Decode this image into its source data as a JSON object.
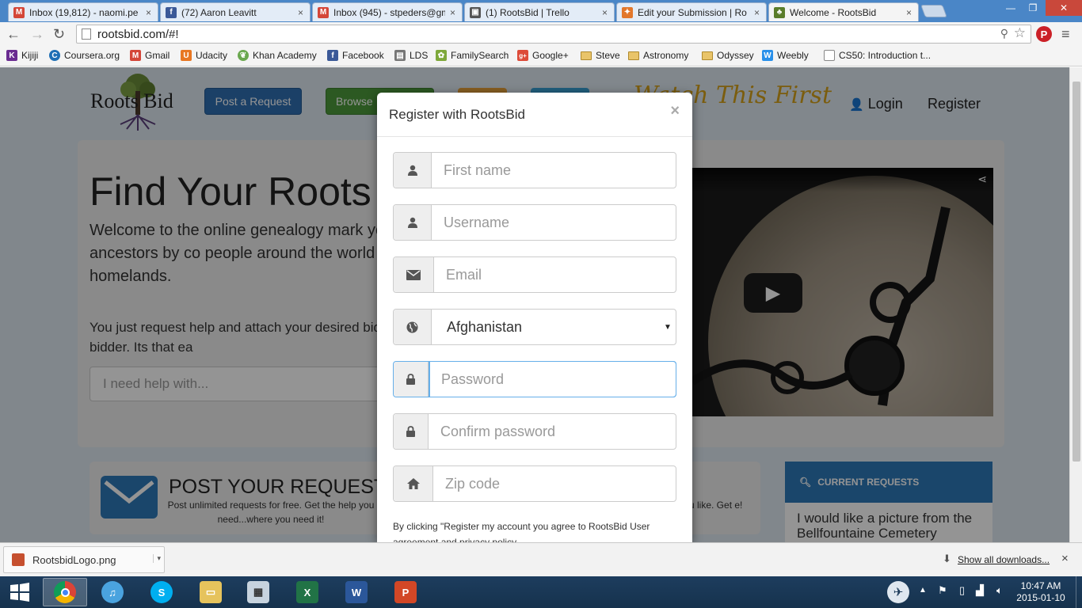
{
  "browser": {
    "tabs": [
      {
        "label": "Inbox (19,812) - naomi.pe",
        "icon": "gmail-icon",
        "color": "#d44638",
        "glyph": "M"
      },
      {
        "label": "(72) Aaron Leavitt",
        "icon": "facebook-icon",
        "color": "#3b5998",
        "glyph": "f"
      },
      {
        "label": "Inbox (945) - stpeders@gm",
        "icon": "gmail-icon",
        "color": "#d44638",
        "glyph": "M"
      },
      {
        "label": "(1) RootsBid | Trello",
        "icon": "trello-icon",
        "color": "#555555",
        "glyph": "▣"
      },
      {
        "label": "Edit your Submission | Ro",
        "icon": "puzzle-icon",
        "color": "#e2772b",
        "glyph": "✦"
      },
      {
        "label": "Welcome - RootsBid",
        "icon": "tree-icon",
        "color": "#5a7d2a",
        "glyph": "♣"
      }
    ],
    "tab_close": "×",
    "url": "rootsbid.com/#!",
    "nav": {
      "back": "←",
      "forward": "→",
      "reload": "↻"
    },
    "bookmarks": [
      {
        "label": "Kijiji",
        "icon": "kijiji-icon",
        "color": "#6a2c91",
        "glyph": "K"
      },
      {
        "label": "Coursera.org",
        "icon": "coursera-icon",
        "color": "#1f6fb5",
        "glyph": "C"
      },
      {
        "label": "Gmail",
        "icon": "gmail-icon",
        "color": "#d44638",
        "glyph": "M"
      },
      {
        "label": "Udacity",
        "icon": "udacity-icon",
        "color": "#e87722",
        "glyph": "U"
      },
      {
        "label": "Khan Academy",
        "icon": "khan-academy-icon",
        "color": "#6aa84f",
        "glyph": "❦"
      },
      {
        "label": "Facebook",
        "icon": "facebook-icon",
        "color": "#3b5998",
        "glyph": "f"
      },
      {
        "label": "LDS",
        "icon": "page-icon",
        "color": "#777777",
        "glyph": "▤"
      },
      {
        "label": "FamilySearch",
        "icon": "familysearch-icon",
        "color": "#7ea83a",
        "glyph": "✿"
      },
      {
        "label": "Google+",
        "icon": "google-plus-icon",
        "color": "#dd4b39",
        "glyph": "g+"
      },
      {
        "label": "Steve",
        "icon": "folder-icon",
        "color": "#e9c46a",
        "glyph": ""
      },
      {
        "label": "Astronomy",
        "icon": "folder-icon",
        "color": "#e9c46a",
        "glyph": ""
      },
      {
        "label": "Odyssey",
        "icon": "folder-icon",
        "color": "#e9c46a",
        "glyph": ""
      },
      {
        "label": "Weebly",
        "icon": "weebly-icon",
        "color": "#2990ea",
        "glyph": "W"
      },
      {
        "label": "CS50: Introduction t...",
        "icon": "page-icon",
        "color": "#888888",
        "glyph": "▢"
      }
    ]
  },
  "site": {
    "logo_text": "Roots Bid",
    "nav": {
      "post": "Post a Request",
      "browse": "Browse",
      "watch": "Watch This First",
      "login": "Login",
      "register": "Register"
    },
    "hero": {
      "title": "Find Your Roots",
      "lead": "Welcome to the online genealogy mark you find records of your ancestors by co people around the world who live in you homelands.",
      "small": "You just request help and attach your desired bids, and hire your preferred bidder. Its that ea",
      "search_placeholder": "I need help with..."
    },
    "post_card": {
      "title": "POST YOUR REQUEST",
      "text": "Post unlimited requests for free. Get the help you need...where you need it!"
    },
    "mid_card": {
      "text": "u like. Get e!"
    },
    "current": {
      "header": "CURRENT REQUESTS",
      "item": "I would like a picture from the Bellfountaine Cemetery"
    }
  },
  "modal": {
    "title": "Register with RootsBid",
    "close": "×",
    "fields": {
      "first_name": "First name",
      "username": "Username",
      "email": "Email",
      "country": "Afghanistan",
      "password": "Password",
      "confirm": "Confirm password",
      "zip": "Zip code"
    },
    "footer": "By clicking \"Register my account you agree to RootsBid User agreement and privacy policy"
  },
  "downloads": {
    "file": "RootsbidLogo.png",
    "show_all": "Show all downloads...",
    "close": "×"
  },
  "taskbar": {
    "time": "10:47 AM",
    "date": "2015-01-10"
  }
}
